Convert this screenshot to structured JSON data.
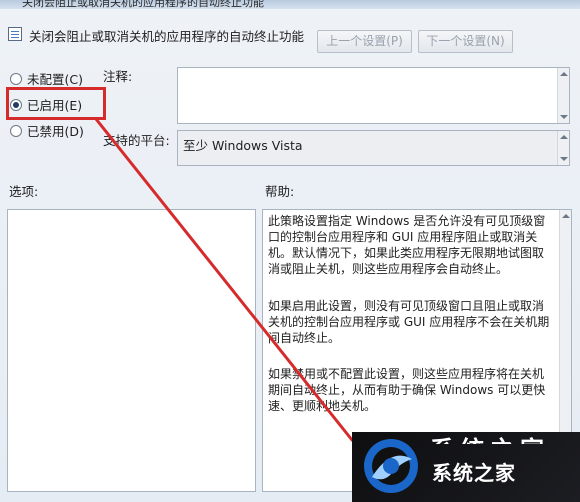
{
  "window": {
    "title": "关闭会阻止或取消关机的应用程序的自动终止功能"
  },
  "header": {
    "policy_name": "关闭会阻止或取消关机的应用程序的自动终止功能",
    "prev_button": "上一个设置(P)",
    "next_button": "下一个设置(N)"
  },
  "state_options": [
    {
      "label": "未配置(C)",
      "checked": false
    },
    {
      "label": "已启用(E)",
      "checked": true
    },
    {
      "label": "已禁用(D)",
      "checked": false
    }
  ],
  "comment": {
    "label": "注释:",
    "value": ""
  },
  "platform": {
    "label": "支持的平台:",
    "value": "至少 Windows Vista"
  },
  "options": {
    "label": "选项:"
  },
  "help": {
    "label": "帮助:",
    "paragraphs": [
      "此策略设置指定 Windows 是否允许没有可见顶级窗口的控制台应用程序和 GUI 应用程序阻止或取消关机。默认情况下，如果此类应用程序无限期地试图取消或阻止关机，则这些应用程序会自动终止。",
      "如果启用此设置，则没有可见顶级窗口且阻止或取消关机的控制台应用程序或 GUI 应用程序不会在关机期间自动终止。",
      "如果禁用或不配置此设置，则这些应用程序将在关机期间自动终止，从而有助于确保 Windows 可以更快速、更顺利地关机。"
    ]
  },
  "watermark": {
    "text": "系统之家"
  },
  "colors": {
    "annotation_red": "#d52b2b",
    "dialog_bg": "#e6ecf3"
  }
}
